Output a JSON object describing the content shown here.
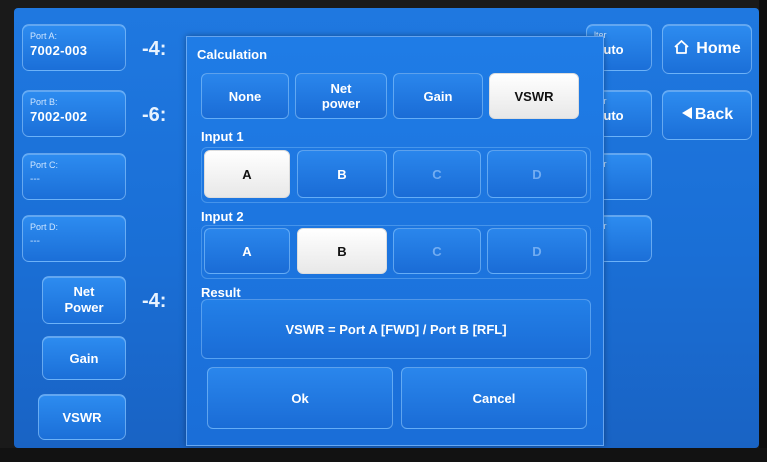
{
  "ports": [
    {
      "label": "Port A:",
      "value": "7002-003",
      "reading": "-4:"
    },
    {
      "label": "Port B:",
      "value": "7002-002",
      "reading": "-6:"
    },
    {
      "label": "Port C:",
      "value": "---"
    },
    {
      "label": "Port D:",
      "value": "---"
    }
  ],
  "left_buttons": {
    "net_power_line1": "Net",
    "net_power_line2": "Power",
    "net_power_reading": "-4:",
    "gain": "Gain",
    "vswr": "VSWR"
  },
  "filters": [
    {
      "label": "lter",
      "value": "Auto"
    },
    {
      "label": "lter",
      "value": "Auto"
    },
    {
      "label": "lter",
      "value": "---"
    },
    {
      "label": "lter",
      "value": "---"
    }
  ],
  "nav": {
    "home_label": "Home",
    "home_icon": "home-icon",
    "back_label": "Back",
    "back_icon": "back-arrow-icon"
  },
  "dialog": {
    "calculation_title": "Calculation",
    "calc_options": [
      {
        "line1": "None",
        "line2": "",
        "selected": false
      },
      {
        "line1": "Net",
        "line2": "power",
        "selected": false
      },
      {
        "line1": "Gain",
        "line2": "",
        "selected": false
      },
      {
        "line1": "VSWR",
        "line2": "",
        "selected": true
      }
    ],
    "input1_title": "Input 1",
    "input1_options": [
      {
        "label": "A",
        "selected": true,
        "enabled": true
      },
      {
        "label": "B",
        "selected": false,
        "enabled": true
      },
      {
        "label": "C",
        "selected": false,
        "enabled": false
      },
      {
        "label": "D",
        "selected": false,
        "enabled": false
      }
    ],
    "input2_title": "Input 2",
    "input2_options": [
      {
        "label": "A",
        "selected": false,
        "enabled": true
      },
      {
        "label": "B",
        "selected": true,
        "enabled": true
      },
      {
        "label": "C",
        "selected": false,
        "enabled": false
      },
      {
        "label": "D",
        "selected": false,
        "enabled": false
      }
    ],
    "result_title": "Result",
    "result_text": "VSWR = Port A [FWD] / Port B [RFL]",
    "ok_label": "Ok",
    "cancel_label": "Cancel"
  },
  "colors": {
    "screen_blue": "#1f78e0",
    "selected_white": "#ffffff",
    "text_white": "#ffffff"
  }
}
